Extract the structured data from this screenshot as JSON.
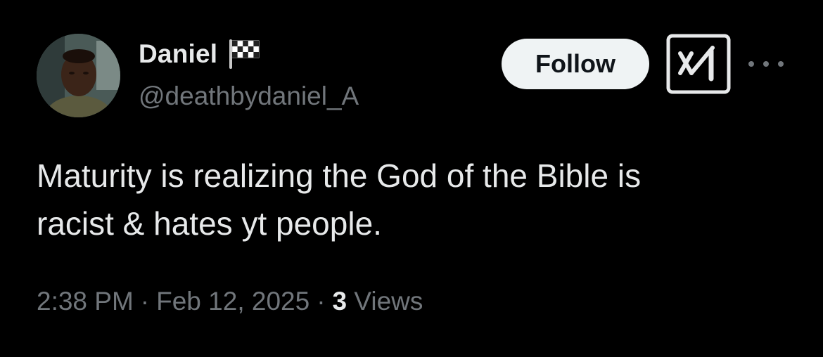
{
  "author": {
    "display_name": "Daniel",
    "handle": "@deathbydaniel_A",
    "emoji_icon": "chequered-flag-icon"
  },
  "actions": {
    "follow_label": "Follow",
    "grok_icon": "grok-icon",
    "more_icon": "more-options-icon"
  },
  "tweet": {
    "text": "Maturity is realizing the God of the Bible is\nracist & hates yt people."
  },
  "meta": {
    "time": "2:38 PM",
    "separator": "·",
    "date": "Feb 12, 2025",
    "views_count": "3",
    "views_label": "Views"
  },
  "colors": {
    "background": "#000000",
    "primary_text": "#e7e9ea",
    "secondary_text": "#71767b",
    "follow_button_bg": "#eff3f4",
    "follow_button_text": "#0f1419"
  }
}
